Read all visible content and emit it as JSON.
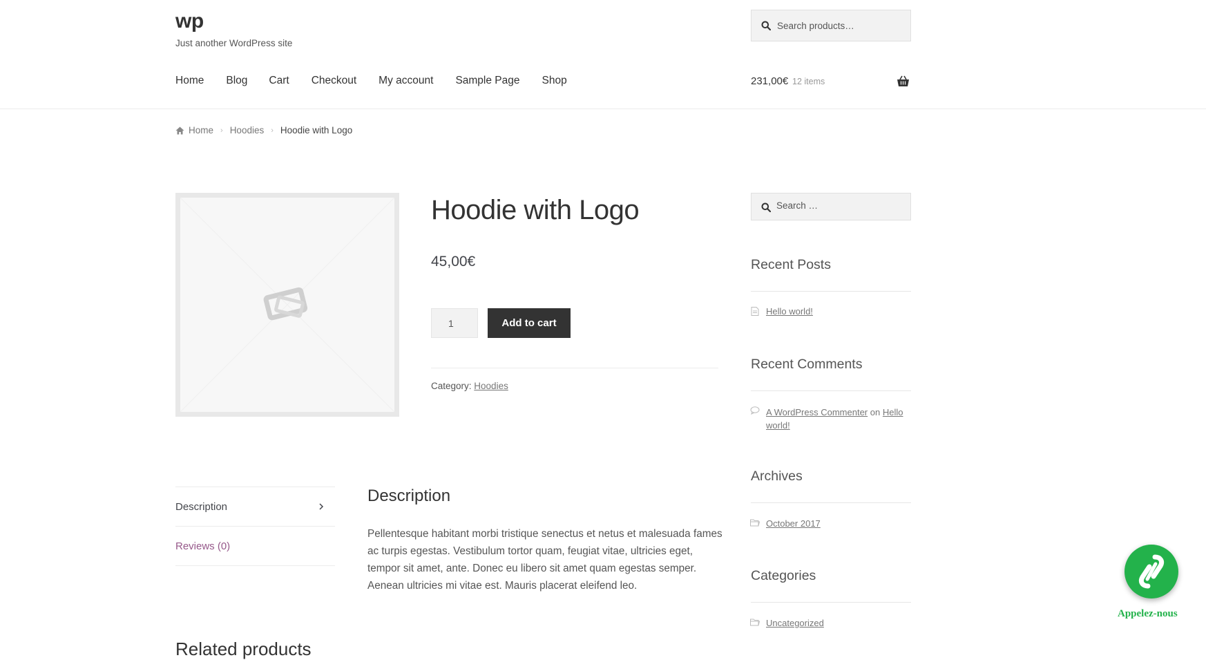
{
  "site": {
    "title": "wp",
    "tagline": "Just another WordPress site"
  },
  "header": {
    "search_placeholder": "Search products…",
    "nav": [
      "Home",
      "Blog",
      "Cart",
      "Checkout",
      "My account",
      "Sample Page",
      "Shop"
    ],
    "cart_total": "231,00€",
    "cart_count": "12 items"
  },
  "breadcrumb": {
    "home": "Home",
    "category": "Hoodies",
    "current": "Hoodie with Logo"
  },
  "product": {
    "title": "Hoodie with Logo",
    "price": "45,00€",
    "quantity": "1",
    "add_to_cart": "Add to cart",
    "category_label": "Category:",
    "category_value": "Hoodies"
  },
  "tabs": {
    "description": "Description",
    "reviews": "Reviews (0)"
  },
  "description": {
    "title": "Description",
    "text": "Pellentesque habitant morbi tristique senectus et netus et malesuada fames ac turpis egestas. Vestibulum tortor quam, feugiat vitae, ultricies eget, tempor sit amet, ante. Donec eu libero sit amet quam egestas semper. Aenean ultricies mi vitae est. Mauris placerat eleifend leo."
  },
  "related_title": "Related products",
  "sidebar": {
    "search_placeholder": "Search …",
    "recent_posts_title": "Recent Posts",
    "recent_post": "Hello world!",
    "recent_comments_title": "Recent Comments",
    "comment_author": "A WordPress Commenter",
    "comment_on": "on",
    "comment_post_line1": "Hello",
    "comment_post_line2": "world!",
    "archives_title": "Archives",
    "archive_item": "October 2017",
    "categories_title": "Categories",
    "category_item": "Uncategorized"
  },
  "call_widget": {
    "label": "Appelez-nous",
    "color": "#23b24b"
  },
  "colors": {
    "accent": "#96588a",
    "button": "#333333"
  }
}
